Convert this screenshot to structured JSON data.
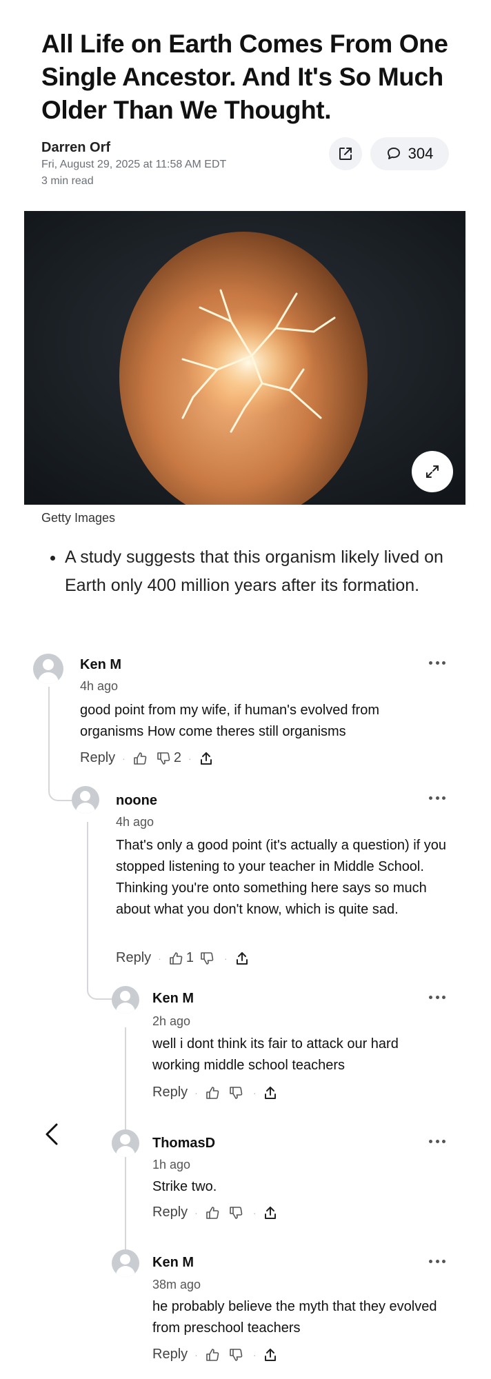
{
  "article": {
    "title": "All Life on Earth Comes From One Single Ancestor. And It's So Much Older Than We Thought.",
    "author": "Darren Orf",
    "date": "Fri, August 29, 2025 at 11:58 AM EDT",
    "read_time": "3 min read",
    "comment_count": "304",
    "image_caption": "Getty Images",
    "bullet": "A study suggests that this organism likely lived on Earth only 400 million years after its formation."
  },
  "comments": [
    {
      "name": "Ken M",
      "time": "4h ago",
      "text": "good point from my wife, if human's evolved from organisms How come theres still organisms",
      "reply_label": "Reply",
      "likes": "",
      "dislikes": "2"
    },
    {
      "name": "noone",
      "time": "4h ago",
      "text": "That's only a good point (it's actually a question) if you stopped listening to your teacher in Middle School. Thinking you're onto something here says so much about what you don't know, which is quite sad.",
      "reply_label": "Reply",
      "likes": "1",
      "dislikes": ""
    },
    {
      "name": "Ken M",
      "time": "2h ago",
      "text": "well i dont think its fair to attack our hard working middle school teachers",
      "reply_label": "Reply",
      "likes": "",
      "dislikes": ""
    },
    {
      "name": "ThomasD",
      "time": "1h ago",
      "text": "Strike two.",
      "reply_label": "Reply",
      "likes": "",
      "dislikes": ""
    },
    {
      "name": "Ken M",
      "time": "38m ago",
      "text": "he probably believe the myth that they evolved from preschool teachers",
      "reply_label": "Reply",
      "likes": "",
      "dislikes": ""
    }
  ],
  "icons": {
    "share": "share-icon",
    "comment": "speech-bubble-icon",
    "expand": "expand-icon",
    "like": "thumbs-up-icon",
    "dislike": "thumbs-down-icon",
    "upload": "upload-icon",
    "more": "more-dots-icon",
    "back": "chevron-left-icon",
    "avatar": "user-avatar-icon"
  },
  "colors": {
    "pill_bg": "#f0f2f5",
    "thread_line": "#d4d6da",
    "avatar_bg": "#c9ccd1"
  }
}
